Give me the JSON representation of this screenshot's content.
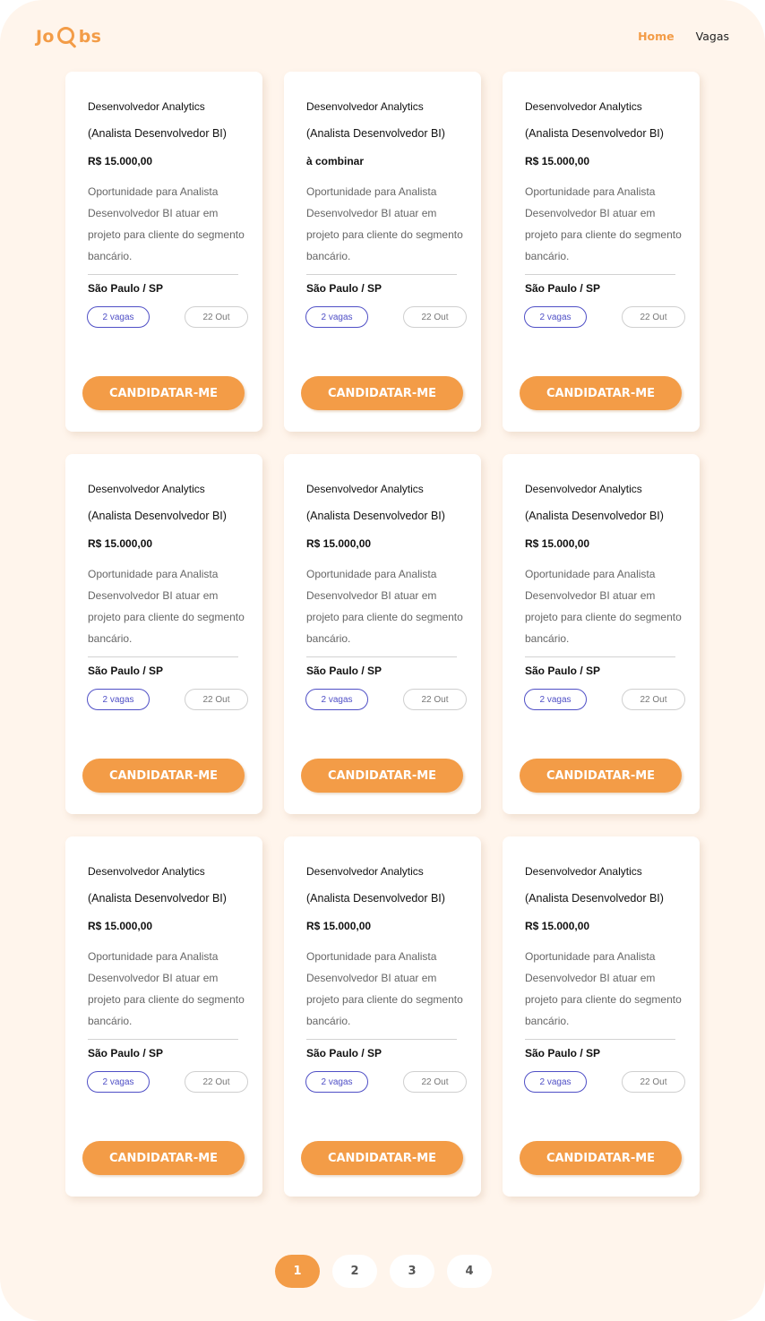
{
  "header": {
    "logo_prefix": "Jo",
    "logo_suffix": "bs",
    "logo_icon": "magnifier-icon",
    "nav": [
      {
        "label": "Home",
        "active": true
      },
      {
        "label": "Vagas",
        "active": false
      }
    ]
  },
  "colors": {
    "accent": "#f39c47",
    "background": "#fff5ec",
    "badge_outline": "#4f4fc6"
  },
  "jobs": [
    {
      "title_line1": "Desenvolvedor Analytics",
      "title_line2": "(Analista Desenvolvedor BI)",
      "salary": "R$ 15.000,00",
      "description": "Oportunidade para Analista Desenvolvedor BI atuar em projeto para cliente do segmento bancário.",
      "location": "São Paulo / SP",
      "openings": "2 vagas",
      "date": "22 Out",
      "apply_label": "CANDIDATAR-ME"
    },
    {
      "title_line1": "Desenvolvedor Analytics",
      "title_line2": "(Analista Desenvolvedor BI)",
      "salary": "à combinar",
      "description": "Oportunidade para Analista Desenvolvedor BI atuar em projeto para cliente do segmento bancário.",
      "location": "São Paulo / SP",
      "openings": "2 vagas",
      "date": "22 Out",
      "apply_label": "CANDIDATAR-ME"
    },
    {
      "title_line1": "Desenvolvedor Analytics",
      "title_line2": "(Analista Desenvolvedor BI)",
      "salary": "R$ 15.000,00",
      "description": "Oportunidade para Analista Desenvolvedor BI atuar em projeto para cliente do segmento bancário.",
      "location": "São Paulo / SP",
      "openings": "2 vagas",
      "date": "22 Out",
      "apply_label": "CANDIDATAR-ME"
    },
    {
      "title_line1": "Desenvolvedor Analytics",
      "title_line2": "(Analista Desenvolvedor BI)",
      "salary": "R$ 15.000,00",
      "description": "Oportunidade para Analista Desenvolvedor BI atuar em projeto para cliente do segmento bancário.",
      "location": "São Paulo / SP",
      "openings": "2 vagas",
      "date": "22 Out",
      "apply_label": "CANDIDATAR-ME"
    },
    {
      "title_line1": "Desenvolvedor Analytics",
      "title_line2": "(Analista Desenvolvedor BI)",
      "salary": "R$ 15.000,00",
      "description": "Oportunidade para Analista Desenvolvedor BI atuar em projeto para cliente do segmento bancário.",
      "location": "São Paulo / SP",
      "openings": "2 vagas",
      "date": "22 Out",
      "apply_label": "CANDIDATAR-ME"
    },
    {
      "title_line1": "Desenvolvedor Analytics",
      "title_line2": "(Analista Desenvolvedor BI)",
      "salary": "R$ 15.000,00",
      "description": "Oportunidade para Analista Desenvolvedor BI atuar em projeto para cliente do segmento bancário.",
      "location": "São Paulo / SP",
      "openings": "2 vagas",
      "date": "22 Out",
      "apply_label": "CANDIDATAR-ME"
    },
    {
      "title_line1": "Desenvolvedor Analytics",
      "title_line2": "(Analista Desenvolvedor BI)",
      "salary": "R$ 15.000,00",
      "description": "Oportunidade para Analista Desenvolvedor BI atuar em projeto para cliente do segmento bancário.",
      "location": "São Paulo / SP",
      "openings": "2 vagas",
      "date": "22 Out",
      "apply_label": "CANDIDATAR-ME"
    },
    {
      "title_line1": "Desenvolvedor Analytics",
      "title_line2": "(Analista Desenvolvedor BI)",
      "salary": "R$ 15.000,00",
      "description": "Oportunidade para Analista Desenvolvedor BI atuar em projeto para cliente do segmento bancário.",
      "location": "São Paulo / SP",
      "openings": "2 vagas",
      "date": "22 Out",
      "apply_label": "CANDIDATAR-ME"
    },
    {
      "title_line1": "Desenvolvedor Analytics",
      "title_line2": "(Analista Desenvolvedor BI)",
      "salary": "R$ 15.000,00",
      "description": "Oportunidade para Analista Desenvolvedor BI atuar em projeto para cliente do segmento bancário.",
      "location": "São Paulo / SP",
      "openings": "2 vagas",
      "date": "22 Out",
      "apply_label": "CANDIDATAR-ME"
    }
  ],
  "pagination": {
    "pages": [
      "1",
      "2",
      "3",
      "4"
    ],
    "current": "1"
  }
}
